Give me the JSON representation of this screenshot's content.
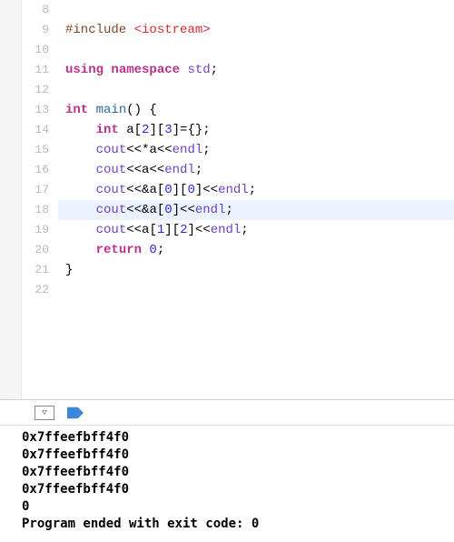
{
  "editor": {
    "startLine": 8,
    "highlightedLine": 18,
    "lines": [
      {
        "n": 8,
        "tokens": []
      },
      {
        "n": 9,
        "tokens": [
          {
            "t": "#include ",
            "c": "tok-preproc"
          },
          {
            "t": "<iostream>",
            "c": "tok-include"
          }
        ]
      },
      {
        "n": 10,
        "tokens": []
      },
      {
        "n": 11,
        "tokens": [
          {
            "t": "using ",
            "c": "tok-keyword"
          },
          {
            "t": "namespace ",
            "c": "tok-keyword"
          },
          {
            "t": "std",
            "c": "tok-ns"
          },
          {
            "t": ";",
            "c": "tok-punct"
          }
        ]
      },
      {
        "n": 12,
        "tokens": []
      },
      {
        "n": 13,
        "tokens": [
          {
            "t": "int ",
            "c": "tok-type"
          },
          {
            "t": "main",
            "c": "tok-func"
          },
          {
            "t": "() {",
            "c": "tok-punct"
          }
        ]
      },
      {
        "n": 14,
        "tokens": [
          {
            "t": "    ",
            "c": ""
          },
          {
            "t": "int ",
            "c": "tok-type"
          },
          {
            "t": "a",
            "c": "tok-ident"
          },
          {
            "t": "[",
            "c": "tok-punct"
          },
          {
            "t": "2",
            "c": "tok-num"
          },
          {
            "t": "][",
            "c": "tok-punct"
          },
          {
            "t": "3",
            "c": "tok-num"
          },
          {
            "t": "]={};",
            "c": "tok-punct"
          }
        ]
      },
      {
        "n": 15,
        "tokens": [
          {
            "t": "    ",
            "c": ""
          },
          {
            "t": "cout",
            "c": "tok-lib"
          },
          {
            "t": "<<*",
            "c": "tok-punct"
          },
          {
            "t": "a",
            "c": "tok-ident"
          },
          {
            "t": "<<",
            "c": "tok-punct"
          },
          {
            "t": "endl",
            "c": "tok-lib"
          },
          {
            "t": ";",
            "c": "tok-punct"
          }
        ]
      },
      {
        "n": 16,
        "tokens": [
          {
            "t": "    ",
            "c": ""
          },
          {
            "t": "cout",
            "c": "tok-lib"
          },
          {
            "t": "<<",
            "c": "tok-punct"
          },
          {
            "t": "a",
            "c": "tok-ident"
          },
          {
            "t": "<<",
            "c": "tok-punct"
          },
          {
            "t": "endl",
            "c": "tok-lib"
          },
          {
            "t": ";",
            "c": "tok-punct"
          }
        ]
      },
      {
        "n": 17,
        "tokens": [
          {
            "t": "    ",
            "c": ""
          },
          {
            "t": "cout",
            "c": "tok-lib"
          },
          {
            "t": "<<&",
            "c": "tok-punct"
          },
          {
            "t": "a",
            "c": "tok-ident"
          },
          {
            "t": "[",
            "c": "tok-punct"
          },
          {
            "t": "0",
            "c": "tok-num"
          },
          {
            "t": "][",
            "c": "tok-punct"
          },
          {
            "t": "0",
            "c": "tok-num"
          },
          {
            "t": "]<<",
            "c": "tok-punct"
          },
          {
            "t": "endl",
            "c": "tok-lib"
          },
          {
            "t": ";",
            "c": "tok-punct"
          }
        ]
      },
      {
        "n": 18,
        "tokens": [
          {
            "t": "    ",
            "c": ""
          },
          {
            "t": "cout",
            "c": "tok-lib"
          },
          {
            "t": "<<&",
            "c": "tok-punct"
          },
          {
            "t": "a",
            "c": "tok-ident"
          },
          {
            "t": "[",
            "c": "tok-punct"
          },
          {
            "t": "0",
            "c": "tok-num"
          },
          {
            "t": "]<<",
            "c": "tok-punct"
          },
          {
            "t": "endl",
            "c": "tok-lib"
          },
          {
            "t": ";",
            "c": "tok-punct"
          }
        ]
      },
      {
        "n": 19,
        "tokens": [
          {
            "t": "    ",
            "c": ""
          },
          {
            "t": "cout",
            "c": "tok-lib"
          },
          {
            "t": "<<",
            "c": "tok-punct"
          },
          {
            "t": "a",
            "c": "tok-ident"
          },
          {
            "t": "[",
            "c": "tok-punct"
          },
          {
            "t": "1",
            "c": "tok-num"
          },
          {
            "t": "][",
            "c": "tok-punct"
          },
          {
            "t": "2",
            "c": "tok-num"
          },
          {
            "t": "]<<",
            "c": "tok-punct"
          },
          {
            "t": "endl",
            "c": "tok-lib"
          },
          {
            "t": ";",
            "c": "tok-punct"
          }
        ]
      },
      {
        "n": 20,
        "tokens": [
          {
            "t": "    ",
            "c": ""
          },
          {
            "t": "return ",
            "c": "tok-keyword"
          },
          {
            "t": "0",
            "c": "tok-num"
          },
          {
            "t": ";",
            "c": "tok-punct"
          }
        ]
      },
      {
        "n": 21,
        "tokens": [
          {
            "t": "}",
            "c": "tok-punct"
          }
        ]
      },
      {
        "n": 22,
        "tokens": []
      }
    ]
  },
  "console": {
    "lines": [
      "0x7ffeefbff4f0",
      "0x7ffeefbff4f0",
      "0x7ffeefbff4f0",
      "0x7ffeefbff4f0",
      "0",
      "Program ended with exit code: 0"
    ]
  }
}
